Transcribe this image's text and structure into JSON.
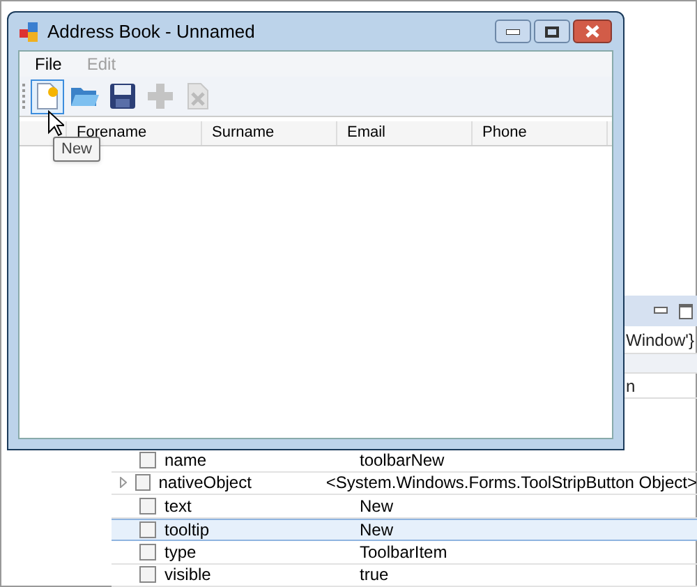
{
  "window": {
    "title": "Address Book - Unnamed"
  },
  "menu": [
    {
      "label": "File",
      "disabled": false
    },
    {
      "label": "Edit",
      "disabled": true
    }
  ],
  "toolbar": [
    {
      "kind": "new",
      "disabled": false,
      "hovered": true
    },
    {
      "kind": "open",
      "disabled": false,
      "hovered": false
    },
    {
      "kind": "save",
      "disabled": false,
      "hovered": false
    },
    {
      "kind": "add",
      "disabled": true,
      "hovered": false
    },
    {
      "kind": "delete",
      "disabled": true,
      "hovered": false
    }
  ],
  "tooltip": "New",
  "columns": [
    "Forename",
    "Surname",
    "Email",
    "Phone"
  ],
  "side_panel": {
    "text_1": "Window'}",
    "text_2": "n"
  },
  "properties": [
    {
      "name": "name",
      "value": "toolbarNew",
      "expandable": false,
      "checked": false,
      "selected": false
    },
    {
      "name": "nativeObject",
      "value": "<System.Windows.Forms.ToolStripButton Object>",
      "expandable": true,
      "checked": false,
      "selected": false
    },
    {
      "name": "text",
      "value": "New",
      "expandable": false,
      "checked": false,
      "selected": false
    },
    {
      "name": "tooltip",
      "value": "New",
      "expandable": false,
      "checked": false,
      "selected": true
    },
    {
      "name": "type",
      "value": "ToolbarItem",
      "expandable": false,
      "checked": false,
      "selected": false
    },
    {
      "name": "visible",
      "value": "true",
      "expandable": false,
      "checked": false,
      "selected": false
    }
  ]
}
